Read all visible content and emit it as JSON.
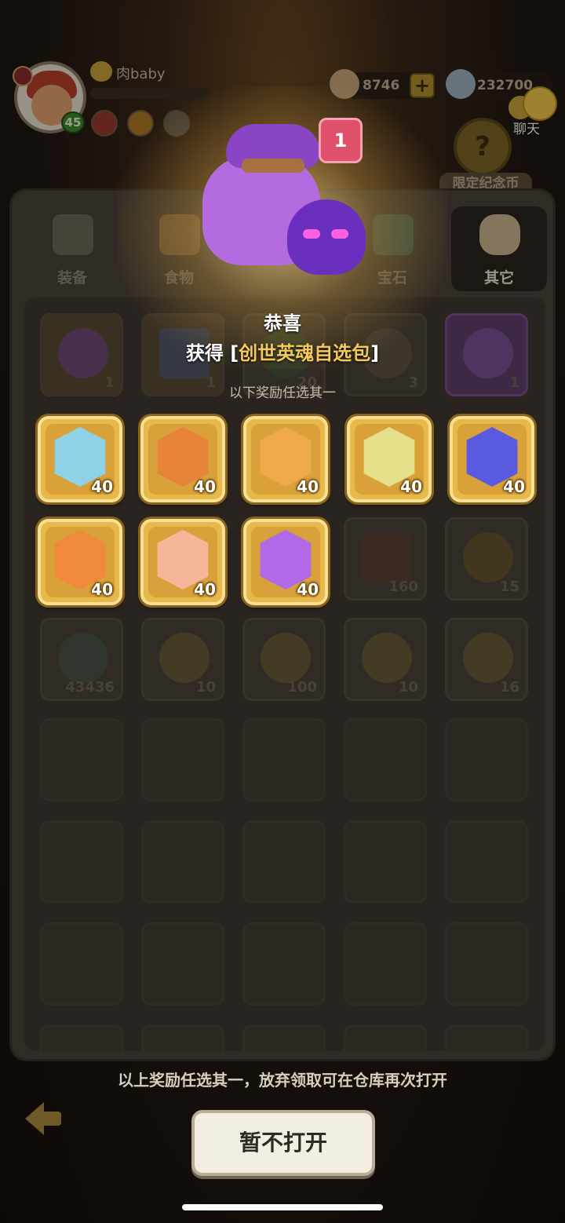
{
  "player": {
    "name": "肉baby",
    "level": "45",
    "xp_fraction": 0.0
  },
  "currencies": [
    {
      "icon": "shell-coin-icon",
      "value": "8746"
    },
    {
      "icon": "silver-coin-icon",
      "value": "232700"
    }
  ],
  "chat": {
    "label": "聊天"
  },
  "limited_coin": {
    "label": "限定纪念币",
    "glyph": "?"
  },
  "tabs": [
    {
      "label": "装备",
      "icon": "equipment-icon"
    },
    {
      "label": "食物",
      "icon": "food-icon"
    },
    {
      "label": "",
      "icon": "item-icon"
    },
    {
      "label": "宝石",
      "icon": "gem-icon"
    },
    {
      "label": "其它",
      "icon": "bone-icon",
      "active": true
    }
  ],
  "popup": {
    "quantity": "1",
    "congrats": "恭喜",
    "obtained_prefix": "获得 [",
    "obtained_item": "创世英魂自选包",
    "obtained_suffix": "]",
    "choose_one": "以下奖励任选其一"
  },
  "inventory_row1": [
    "1",
    "1",
    "20",
    "3",
    "1"
  ],
  "rewards": [
    {
      "count": "40",
      "color": "#8fd2e8"
    },
    {
      "count": "40",
      "color": "#e8843a"
    },
    {
      "count": "40",
      "color": "#f0a94a"
    },
    {
      "count": "40",
      "color": "#e6e08a"
    },
    {
      "count": "40",
      "color": "#5a5ae0"
    },
    {
      "count": "40",
      "color": "#f08a3a"
    },
    {
      "count": "40",
      "color": "#f6b69a"
    },
    {
      "count": "40",
      "color": "#b06ae8"
    }
  ],
  "inventory_row2_extra": [
    "160",
    "15"
  ],
  "inventory_row3": [
    "43436",
    "10",
    "100",
    "10",
    "16"
  ],
  "footer_note": "以上奖励任选其一，放弃领取可在仓库再次打开",
  "primary_button": "暂不打开"
}
